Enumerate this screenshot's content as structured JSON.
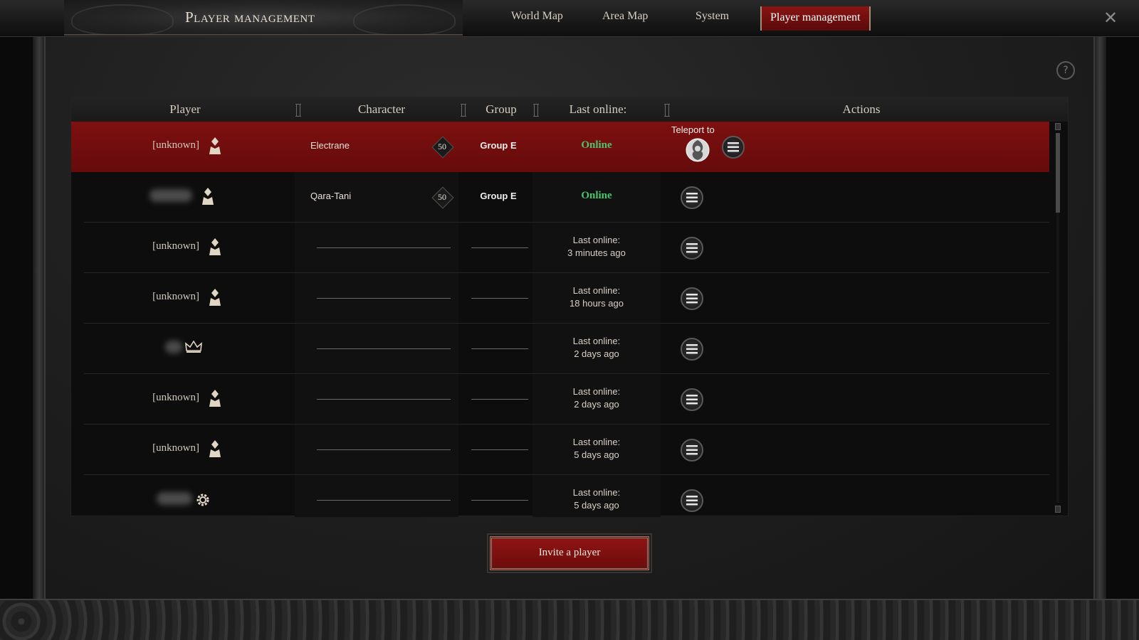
{
  "header": {
    "title": "Player management",
    "tabs": [
      {
        "label": "World Map"
      },
      {
        "label": "Area Map"
      },
      {
        "label": "System"
      },
      {
        "label": "Player management",
        "active": true
      }
    ]
  },
  "table": {
    "columns": {
      "player": "Player",
      "character": "Character",
      "group": "Group",
      "last_online": "Last online:",
      "actions": "Actions"
    },
    "teleport_label": "Teleport to",
    "rows": [
      {
        "player": "[unknown]",
        "player_blurred": false,
        "role_icon": "person-icon",
        "character": "Electrane",
        "level": "50",
        "group": "Group E",
        "status": "Online",
        "selected": true
      },
      {
        "player": "",
        "player_blurred": true,
        "role_icon": "person-icon",
        "character": "Qara-Tani",
        "level": "50",
        "group": "Group E",
        "status": "Online"
      },
      {
        "player": "[unknown]",
        "player_blurred": false,
        "role_icon": "person-icon",
        "status_line1": "Last online:",
        "status_line2": "3 minutes ago"
      },
      {
        "player": "[unknown]",
        "player_blurred": false,
        "role_icon": "person-icon",
        "status_line1": "Last online:",
        "status_line2": "18 hours ago"
      },
      {
        "player": "",
        "player_blurred": true,
        "role_icon": "crown-icon",
        "status_line1": "Last online:",
        "status_line2": "2 days ago"
      },
      {
        "player": "[unknown]",
        "player_blurred": false,
        "role_icon": "person-icon",
        "status_line1": "Last online:",
        "status_line2": "2 days ago"
      },
      {
        "player": "[unknown]",
        "player_blurred": false,
        "role_icon": "person-icon",
        "status_line1": "Last online:",
        "status_line2": "5 days ago"
      },
      {
        "player": "",
        "player_blurred": true,
        "role_icon": "gear-icon",
        "status_line1": "Last online:",
        "status_line2": "5 days ago"
      }
    ]
  },
  "footer": {
    "invite_label": "Invite a player"
  },
  "colors": {
    "accent_red": "#7e1010",
    "online_green": "#4cc46e"
  },
  "icons": {
    "close": "close-icon",
    "help": "help-icon",
    "menu": "menu-icon",
    "teleport": "teleport-icon"
  }
}
